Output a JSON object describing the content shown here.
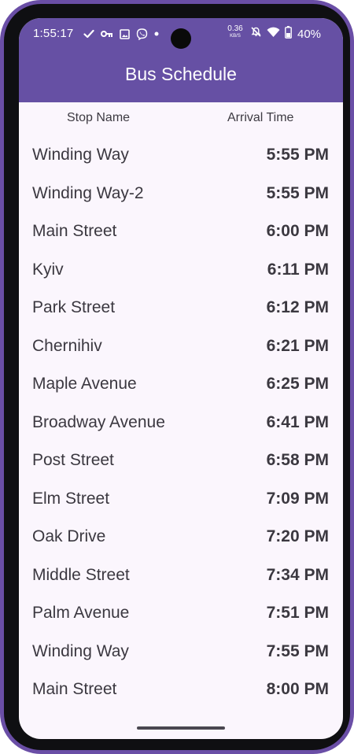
{
  "status_bar": {
    "time": "1:55:17",
    "net_speed_value": "0.36",
    "net_speed_unit": "KB/S",
    "battery_percent": "40%",
    "icons_left": [
      "check-icon",
      "key-icon",
      "image-icon",
      "viber-icon",
      "dot-icon"
    ],
    "icons_right": [
      "mute-icon",
      "wifi-icon",
      "battery-icon"
    ]
  },
  "app_bar": {
    "title": "Bus Schedule",
    "color": "#6650a4"
  },
  "table": {
    "headers": {
      "stop": "Stop Name",
      "time": "Arrival Time"
    },
    "rows": [
      {
        "stop": "Winding Way",
        "time": "5:55 PM"
      },
      {
        "stop": "Winding Way-2",
        "time": "5:55 PM"
      },
      {
        "stop": "Main Street",
        "time": "6:00 PM"
      },
      {
        "stop": "Kyiv",
        "time": "6:11 PM"
      },
      {
        "stop": "Park Street",
        "time": "6:12 PM"
      },
      {
        "stop": "Chernihiv",
        "time": "6:21 PM"
      },
      {
        "stop": "Maple Avenue",
        "time": "6:25 PM"
      },
      {
        "stop": "Broadway Avenue",
        "time": "6:41 PM"
      },
      {
        "stop": "Post Street",
        "time": "6:58 PM"
      },
      {
        "stop": "Elm Street",
        "time": "7:09 PM"
      },
      {
        "stop": "Oak Drive",
        "time": "7:20 PM"
      },
      {
        "stop": "Middle Street",
        "time": "7:34 PM"
      },
      {
        "stop": "Palm Avenue",
        "time": "7:51 PM"
      },
      {
        "stop": "Winding Way",
        "time": "7:55 PM"
      },
      {
        "stop": "Main Street",
        "time": "8:00 PM"
      }
    ]
  },
  "colors": {
    "device_frame": "#6a4ea6",
    "screen_background": "#fbf6fd",
    "text": "#3b3840"
  }
}
